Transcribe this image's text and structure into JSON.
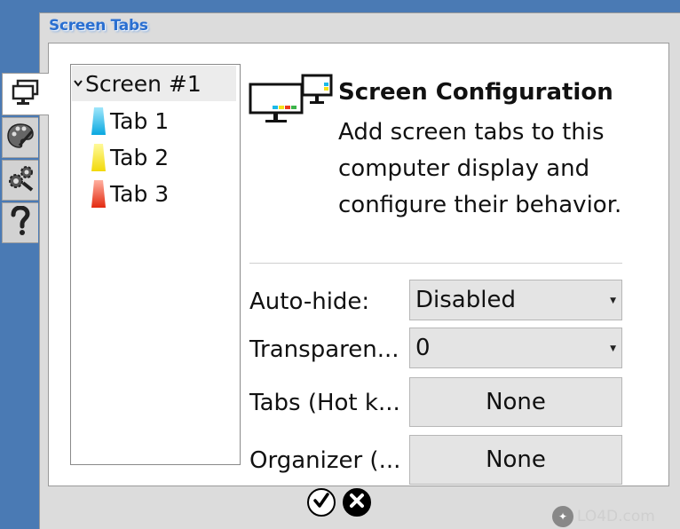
{
  "window": {
    "title": "Screen Tabs"
  },
  "side_tabs": [
    {
      "id": "screens",
      "icon": "monitor-icon",
      "active": true
    },
    {
      "id": "appearance",
      "icon": "palette-icon",
      "active": false
    },
    {
      "id": "settings",
      "icon": "gears-icon",
      "active": false
    },
    {
      "id": "help",
      "icon": "question-icon",
      "active": false
    }
  ],
  "tree": {
    "root": {
      "label": "Screen #1",
      "expanded": true
    },
    "items": [
      {
        "label": "Tab 1",
        "color": "#1ab9e8"
      },
      {
        "label": "Tab 2",
        "color": "#f4e21a"
      },
      {
        "label": "Tab 3",
        "color": "#ec3a1e"
      }
    ]
  },
  "config": {
    "title": "Screen Configuration",
    "description": "Add screen tabs to this computer display and configure their behavior."
  },
  "fields": {
    "autohide": {
      "label": "Auto-hide:",
      "value": "Disabled"
    },
    "transparency": {
      "label": "Transparen...",
      "value": "0"
    },
    "tabs_hotkey": {
      "label": "Tabs (Hot k...",
      "value": "None"
    },
    "organizer": {
      "label": "Organizer (...",
      "value": "None"
    }
  },
  "buttons": {
    "ok": "ok-check",
    "cancel": "cancel-x"
  },
  "watermark": {
    "text": "LO4D.com"
  },
  "colors": {
    "title": "#2a6fd1",
    "desktop": "#4a7ab4"
  }
}
